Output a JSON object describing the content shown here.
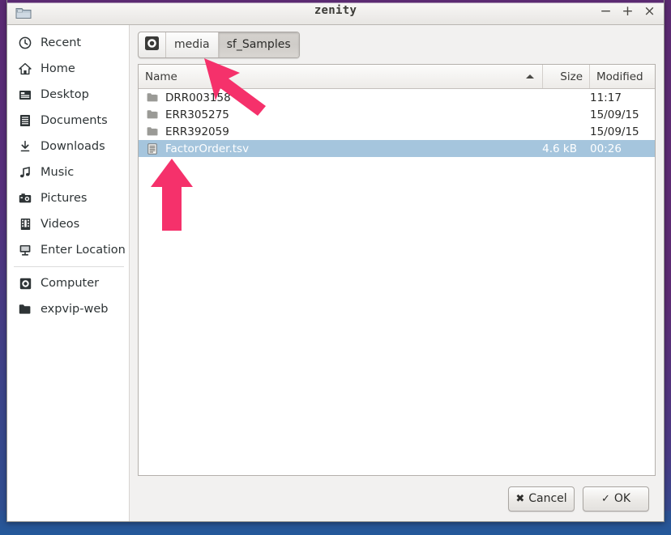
{
  "window": {
    "title": "zenity",
    "icon": "folder-icon",
    "buttons": [
      {
        "name": "minimize-button",
        "glyph": "−"
      },
      {
        "name": "maximize-button",
        "glyph": "+"
      },
      {
        "name": "close-button",
        "glyph": "×"
      }
    ]
  },
  "sidebar": {
    "items": [
      {
        "label": "Recent",
        "icon": "clock-icon"
      },
      {
        "label": "Home",
        "icon": "home-icon"
      },
      {
        "label": "Desktop",
        "icon": "desktop-icon"
      },
      {
        "label": "Documents",
        "icon": "documents-icon"
      },
      {
        "label": "Downloads",
        "icon": "download-icon"
      },
      {
        "label": "Music",
        "icon": "music-note-icon"
      },
      {
        "label": "Pictures",
        "icon": "camera-icon"
      },
      {
        "label": "Videos",
        "icon": "film-icon"
      },
      {
        "label": "Enter Location",
        "icon": "monitor-icon"
      },
      {
        "label": "Computer",
        "icon": "drive-icon",
        "separator_before": true
      },
      {
        "label": "expvip-web",
        "icon": "folder-icon"
      }
    ]
  },
  "pathbar": {
    "crumbs": [
      {
        "label": "",
        "icon": "drive-icon",
        "active": false
      },
      {
        "label": "media",
        "icon": "",
        "active": false
      },
      {
        "label": "sf_Samples",
        "icon": "",
        "active": true
      }
    ]
  },
  "filelist": {
    "columns": [
      {
        "label": "Name",
        "sorted": true,
        "sort_direction": "ascending"
      },
      {
        "label": "Size",
        "sorted": false,
        "sort_direction": ""
      },
      {
        "label": "Modified",
        "sorted": false,
        "sort_direction": ""
      }
    ],
    "rows": [
      {
        "name": "DRR003158",
        "size": "",
        "modified": "11:17",
        "icon": "folder-icon",
        "selected": false
      },
      {
        "name": "ERR305275",
        "size": "",
        "modified": "15/09/15",
        "icon": "folder-icon",
        "selected": false
      },
      {
        "name": "ERR392059",
        "size": "",
        "modified": "15/09/15",
        "icon": "folder-icon",
        "selected": false
      },
      {
        "name": "FactorOrder.tsv",
        "size": "4.6 kB",
        "modified": "00:26",
        "icon": "document-icon",
        "selected": true
      }
    ]
  },
  "actions": {
    "cancel": {
      "label": "Cancel",
      "icon": "✖"
    },
    "ok": {
      "label": "OK",
      "icon": "✓"
    }
  },
  "colors": {
    "selection": "#a5c5dd",
    "annotation_arrow": "#f5316b",
    "desktop_purple": "#5b2a72",
    "desktop_blue": "#24599a",
    "window_chrome": "#f2f1f0"
  }
}
